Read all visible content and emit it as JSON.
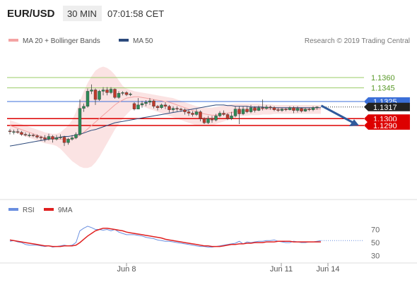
{
  "header": {
    "symbol": "EUR/USD",
    "timeframe": "30 MIN",
    "time": "07:01:58 CET"
  },
  "legend": {
    "bollinger": "MA 20 + Bollinger Bands",
    "ma50": "MA 50",
    "credit": "Research © 2019 Trading Central"
  },
  "colors": {
    "up_candle": "#2e8b57",
    "down_candle": "#c0392b",
    "ma20": "#f4a3a3",
    "ma50": "#2c4a7c",
    "bollinger_fill": "#fbe3e3",
    "resistance": "#99cc66",
    "pivot": "#3b6fd8",
    "support": "#dd0000",
    "rsi": "#6a8fe0",
    "rsi_ma": "#e02020",
    "arrow": "#2f5a9c"
  },
  "chart_data": [
    {
      "type": "candlestick",
      "title": "EUR/USD 30 MIN",
      "ylim": [
        1.3185,
        1.3395
      ],
      "x_ticks": [
        "Jun 8",
        "Jun 11",
        "Jun 14"
      ],
      "price_levels": [
        {
          "label": "1.1360",
          "value": 1.336,
          "kind": "resistance"
        },
        {
          "label": "1.1345",
          "value": 1.3345,
          "kind": "resistance"
        },
        {
          "label": "1.1325",
          "value": 1.3325,
          "kind": "pivot"
        },
        {
          "label": "1.1317",
          "value": 1.3317,
          "kind": "last"
        },
        {
          "label": "1.1300",
          "value": 1.33,
          "kind": "support"
        },
        {
          "label": "1.1290",
          "value": 1.329,
          "kind": "support"
        }
      ],
      "candles": [
        [
          1.3282,
          1.3281,
          1.3285,
          1.3277
        ],
        [
          1.3281,
          1.3281,
          1.3284,
          1.3277
        ],
        [
          1.3281,
          1.328,
          1.3285,
          1.3278
        ],
        [
          1.328,
          1.3277,
          1.3282,
          1.3275
        ],
        [
          1.3277,
          1.3276,
          1.328,
          1.3274
        ],
        [
          1.3276,
          1.3276,
          1.3279,
          1.3273
        ],
        [
          1.3276,
          1.3275,
          1.3278,
          1.3273
        ],
        [
          1.3275,
          1.3273,
          1.3277,
          1.3271
        ],
        [
          1.3273,
          1.3272,
          1.3275,
          1.3268
        ],
        [
          1.3272,
          1.327,
          1.3276,
          1.3266
        ],
        [
          1.327,
          1.3274,
          1.3278,
          1.3268
        ],
        [
          1.3274,
          1.327,
          1.3276,
          1.3265
        ],
        [
          1.327,
          1.3272,
          1.3276,
          1.3268
        ],
        [
          1.3272,
          1.3273,
          1.3277,
          1.327
        ],
        [
          1.3273,
          1.3265,
          1.3275,
          1.326
        ],
        [
          1.3265,
          1.327,
          1.3272,
          1.3262
        ],
        [
          1.327,
          1.3272,
          1.3276,
          1.3268
        ],
        [
          1.3272,
          1.3277,
          1.328,
          1.327
        ],
        [
          1.3277,
          1.3315,
          1.3328,
          1.3275
        ],
        [
          1.3315,
          1.3318,
          1.3322,
          1.331
        ],
        [
          1.3318,
          1.334,
          1.3344,
          1.3316
        ],
        [
          1.334,
          1.3342,
          1.335,
          1.3336
        ],
        [
          1.3342,
          1.3328,
          1.3344,
          1.332
        ],
        [
          1.3328,
          1.334,
          1.3342,
          1.3326
        ],
        [
          1.334,
          1.3342,
          1.3346,
          1.3334
        ],
        [
          1.3342,
          1.3338,
          1.3346,
          1.3334
        ],
        [
          1.3338,
          1.3343,
          1.3346,
          1.3336
        ],
        [
          1.3343,
          1.3331,
          1.3344,
          1.3329
        ],
        [
          1.3331,
          1.3337,
          1.334,
          1.3329
        ],
        [
          1.3337,
          1.3338,
          1.334,
          1.3334
        ],
        [
          1.3338,
          1.3335,
          1.334,
          1.3333
        ],
        [
          1.3335,
          1.3336,
          1.3338,
          1.3333
        ],
        [
          1.3322,
          1.3314,
          1.3324,
          1.3312
        ],
        [
          1.3314,
          1.332,
          1.333,
          1.3314
        ],
        [
          1.332,
          1.3322,
          1.3326,
          1.3316
        ],
        [
          1.3322,
          1.3324,
          1.3327,
          1.3318
        ],
        [
          1.3324,
          1.3326,
          1.333,
          1.332
        ],
        [
          1.3326,
          1.3318,
          1.3328,
          1.3315
        ],
        [
          1.3318,
          1.3316,
          1.332,
          1.3312
        ],
        [
          1.3316,
          1.332,
          1.3322,
          1.3314
        ],
        [
          1.332,
          1.3318,
          1.3324,
          1.3314
        ],
        [
          1.3318,
          1.3313,
          1.332,
          1.3309
        ],
        [
          1.3313,
          1.3315,
          1.3318,
          1.331
        ],
        [
          1.3315,
          1.3314,
          1.3318,
          1.3311
        ],
        [
          1.3314,
          1.3313,
          1.3316,
          1.331
        ],
        [
          1.3313,
          1.331,
          1.3315,
          1.3306
        ],
        [
          1.331,
          1.3308,
          1.3313,
          1.3304
        ],
        [
          1.3308,
          1.3306,
          1.3311,
          1.3303
        ],
        [
          1.3306,
          1.331,
          1.3314,
          1.3304
        ],
        [
          1.331,
          1.33,
          1.3312,
          1.3296
        ],
        [
          1.33,
          1.3294,
          1.3302,
          1.3292
        ],
        [
          1.3294,
          1.33,
          1.3304,
          1.3292
        ],
        [
          1.33,
          1.3298,
          1.3304,
          1.3294
        ],
        [
          1.3298,
          1.3304,
          1.3307,
          1.3296
        ],
        [
          1.3304,
          1.3308,
          1.3311,
          1.3302
        ],
        [
          1.3308,
          1.3306,
          1.3312,
          1.3304
        ],
        [
          1.3306,
          1.33,
          1.3308,
          1.3298
        ],
        [
          1.33,
          1.3304,
          1.331,
          1.3298
        ],
        [
          1.3304,
          1.3314,
          1.3318,
          1.3302
        ],
        [
          1.3314,
          1.3307,
          1.3318,
          1.3292
        ],
        [
          1.3307,
          1.3314,
          1.3318,
          1.3305
        ],
        [
          1.3314,
          1.331,
          1.3318,
          1.3308
        ],
        [
          1.331,
          1.3316,
          1.332,
          1.3308
        ],
        [
          1.3316,
          1.3312,
          1.3318,
          1.3309
        ],
        [
          1.3312,
          1.3316,
          1.3319,
          1.3311
        ],
        [
          1.3316,
          1.3315,
          1.3328,
          1.3312
        ],
        [
          1.3315,
          1.3317,
          1.332,
          1.3313
        ],
        [
          1.3317,
          1.3316,
          1.3319,
          1.3313
        ],
        [
          1.3316,
          1.3313,
          1.3318,
          1.3311
        ],
        [
          1.3313,
          1.3312,
          1.3316,
          1.331
        ],
        [
          1.3312,
          1.3314,
          1.3316,
          1.331
        ],
        [
          1.3314,
          1.3313,
          1.3316,
          1.3311
        ],
        [
          1.3313,
          1.3316,
          1.3318,
          1.3312
        ],
        [
          1.3316,
          1.3312,
          1.3318,
          1.3308
        ],
        [
          1.3312,
          1.3315,
          1.3318,
          1.3309
        ],
        [
          1.3315,
          1.3311,
          1.3316,
          1.3309
        ],
        [
          1.3311,
          1.3314,
          1.3316,
          1.331
        ],
        [
          1.3314,
          1.3313,
          1.3316,
          1.3311
        ],
        [
          1.3313,
          1.3316,
          1.3318,
          1.3311
        ],
        [
          1.3316,
          1.3317,
          1.3318,
          1.3313
        ]
      ],
      "ma50": [
        1.326,
        1.3261,
        1.3262,
        1.3263,
        1.3264,
        1.3265,
        1.3266,
        1.3267,
        1.3268,
        1.3269,
        1.327,
        1.3271,
        1.3272,
        1.3273,
        1.3274,
        1.3274,
        1.3275,
        1.3276,
        1.3277,
        1.3279,
        1.3281,
        1.3283,
        1.3284,
        1.3286,
        1.3288,
        1.329,
        1.3292,
        1.3294,
        1.3295,
        1.3296,
        1.3297,
        1.3298,
        1.3299,
        1.33,
        1.3301,
        1.3302,
        1.3303,
        1.3304,
        1.3305,
        1.3306,
        1.3307,
        1.3308,
        1.3309,
        1.331,
        1.3311,
        1.3312,
        1.3313,
        1.3314,
        1.3315,
        1.3316,
        1.3317,
        1.3318,
        1.3319,
        1.332,
        1.332,
        1.332,
        1.3319,
        1.3319,
        1.3318,
        1.3318,
        1.3318,
        1.3318,
        1.3317,
        1.3317,
        1.3317,
        1.3317,
        1.3316,
        1.3316,
        1.3316,
        1.3316,
        1.3316,
        1.3316,
        1.3316,
        1.3316,
        1.3316,
        1.3316,
        1.3316,
        1.3316,
        1.3316,
        1.3316,
        1.3316
      ],
      "ma20": [
        1.329,
        1.3288,
        1.3286,
        1.3284,
        1.3282,
        1.328,
        1.3278,
        1.3276,
        1.3274,
        1.3272,
        1.3271,
        1.327,
        1.327,
        1.327,
        1.327,
        1.327,
        1.327,
        1.3272,
        1.3276,
        1.328,
        1.3285,
        1.329,
        1.3295,
        1.33,
        1.3305,
        1.331,
        1.3315,
        1.332,
        1.3324,
        1.3327,
        1.333,
        1.3331,
        1.3332,
        1.3332,
        1.3331,
        1.333,
        1.3329,
        1.3328,
        1.3327,
        1.3326,
        1.3325,
        1.3324,
        1.3322,
        1.332,
        1.3318,
        1.3316,
        1.3314,
        1.3312,
        1.331,
        1.3308,
        1.3307,
        1.3306,
        1.3305,
        1.3305,
        1.3306,
        1.3307,
        1.3308,
        1.3309,
        1.331,
        1.3311,
        1.3311,
        1.3312,
        1.3313,
        1.3313,
        1.3314,
        1.3314,
        1.3314,
        1.3314,
        1.3314,
        1.3314,
        1.3314,
        1.3314,
        1.3314,
        1.3314,
        1.3314,
        1.3314,
        1.3314,
        1.3314,
        1.3314,
        1.3314,
        1.3314
      ],
      "bollinger_upper": [
        1.3298,
        1.3296,
        1.3294,
        1.3292,
        1.329,
        1.3288,
        1.3286,
        1.3284,
        1.3282,
        1.328,
        1.3279,
        1.3278,
        1.3278,
        1.328,
        1.3285,
        1.329,
        1.3298,
        1.331,
        1.3325,
        1.334,
        1.3352,
        1.3362,
        1.337,
        1.3374,
        1.3376,
        1.3374,
        1.337,
        1.3364,
        1.3356,
        1.3348,
        1.3344,
        1.3342,
        1.334,
        1.3339,
        1.3338,
        1.3337,
        1.3336,
        1.3335,
        1.3334,
        1.3333,
        1.3332,
        1.3331,
        1.333,
        1.3328,
        1.3326,
        1.3324,
        1.3322,
        1.332,
        1.3318,
        1.3317,
        1.3316,
        1.3316,
        1.3316,
        1.3317,
        1.3318,
        1.3319,
        1.332,
        1.3321,
        1.3322,
        1.3322,
        1.3322,
        1.3322,
        1.3322,
        1.3322,
        1.3322,
        1.3321,
        1.3321,
        1.3321,
        1.332,
        1.332,
        1.332,
        1.332,
        1.332,
        1.332,
        1.332,
        1.332,
        1.332,
        1.332,
        1.332,
        1.332,
        1.332
      ],
      "bollinger_lower": [
        1.3282,
        1.328,
        1.3278,
        1.3276,
        1.3274,
        1.3272,
        1.327,
        1.3268,
        1.3266,
        1.3264,
        1.3263,
        1.3262,
        1.326,
        1.3256,
        1.325,
        1.3244,
        1.3238,
        1.3234,
        1.323,
        1.3228,
        1.3228,
        1.323,
        1.3236,
        1.3244,
        1.3254,
        1.3264,
        1.3274,
        1.3284,
        1.3292,
        1.33,
        1.3306,
        1.3312,
        1.3316,
        1.3318,
        1.3318,
        1.3316,
        1.3314,
        1.3312,
        1.331,
        1.3308,
        1.3306,
        1.3304,
        1.3302,
        1.33,
        1.3298,
        1.3296,
        1.3294,
        1.3292,
        1.329,
        1.329,
        1.329,
        1.329,
        1.329,
        1.3292,
        1.3294,
        1.3296,
        1.3298,
        1.33,
        1.3302,
        1.3303,
        1.3304,
        1.3304,
        1.3305,
        1.3305,
        1.3305,
        1.3306,
        1.3306,
        1.3306,
        1.3307,
        1.3307,
        1.3307,
        1.3307,
        1.3307,
        1.3307,
        1.3307,
        1.3307,
        1.3307,
        1.3307,
        1.3307,
        1.3307,
        1.3307
      ]
    },
    {
      "type": "line",
      "title": "RSI",
      "ylim": [
        22,
        90
      ],
      "y_ticks": [
        30,
        50,
        70
      ],
      "series": [
        {
          "name": "RSI",
          "values": [
            52,
            53,
            51,
            50,
            47,
            46,
            46,
            46,
            45,
            44,
            45,
            43,
            44,
            45,
            46,
            45,
            46,
            50,
            68,
            72,
            75,
            73,
            70,
            70,
            69,
            70,
            68,
            70,
            66,
            64,
            62,
            62,
            62,
            61,
            60,
            58,
            57,
            56,
            54,
            53,
            52,
            52,
            51,
            50,
            49,
            48,
            47,
            46,
            45,
            44,
            44,
            43,
            43,
            44,
            45,
            46,
            47,
            48,
            49,
            52,
            48,
            51,
            50,
            51,
            52,
            52,
            53,
            53,
            54,
            52,
            51,
            50,
            50,
            52,
            51,
            50,
            50,
            51,
            51,
            52,
            53
          ]
        },
        {
          "name": "9MA",
          "values": [
            54,
            53,
            52,
            51,
            50,
            49,
            48,
            47,
            46,
            45,
            45,
            44,
            44,
            44,
            45,
            45,
            45,
            46,
            50,
            55,
            60,
            64,
            68,
            70,
            72,
            72,
            71,
            70,
            69,
            68,
            66,
            65,
            64,
            63,
            62,
            61,
            60,
            59,
            58,
            57,
            55,
            54,
            53,
            52,
            51,
            50,
            49,
            48,
            47,
            46,
            45,
            45,
            44,
            44,
            44,
            45,
            46,
            47,
            47,
            48,
            48,
            49,
            49,
            50,
            50,
            50,
            51,
            51,
            51,
            52,
            52,
            52,
            52,
            51,
            51,
            51,
            51,
            51,
            51,
            51,
            51
          ]
        }
      ]
    }
  ]
}
